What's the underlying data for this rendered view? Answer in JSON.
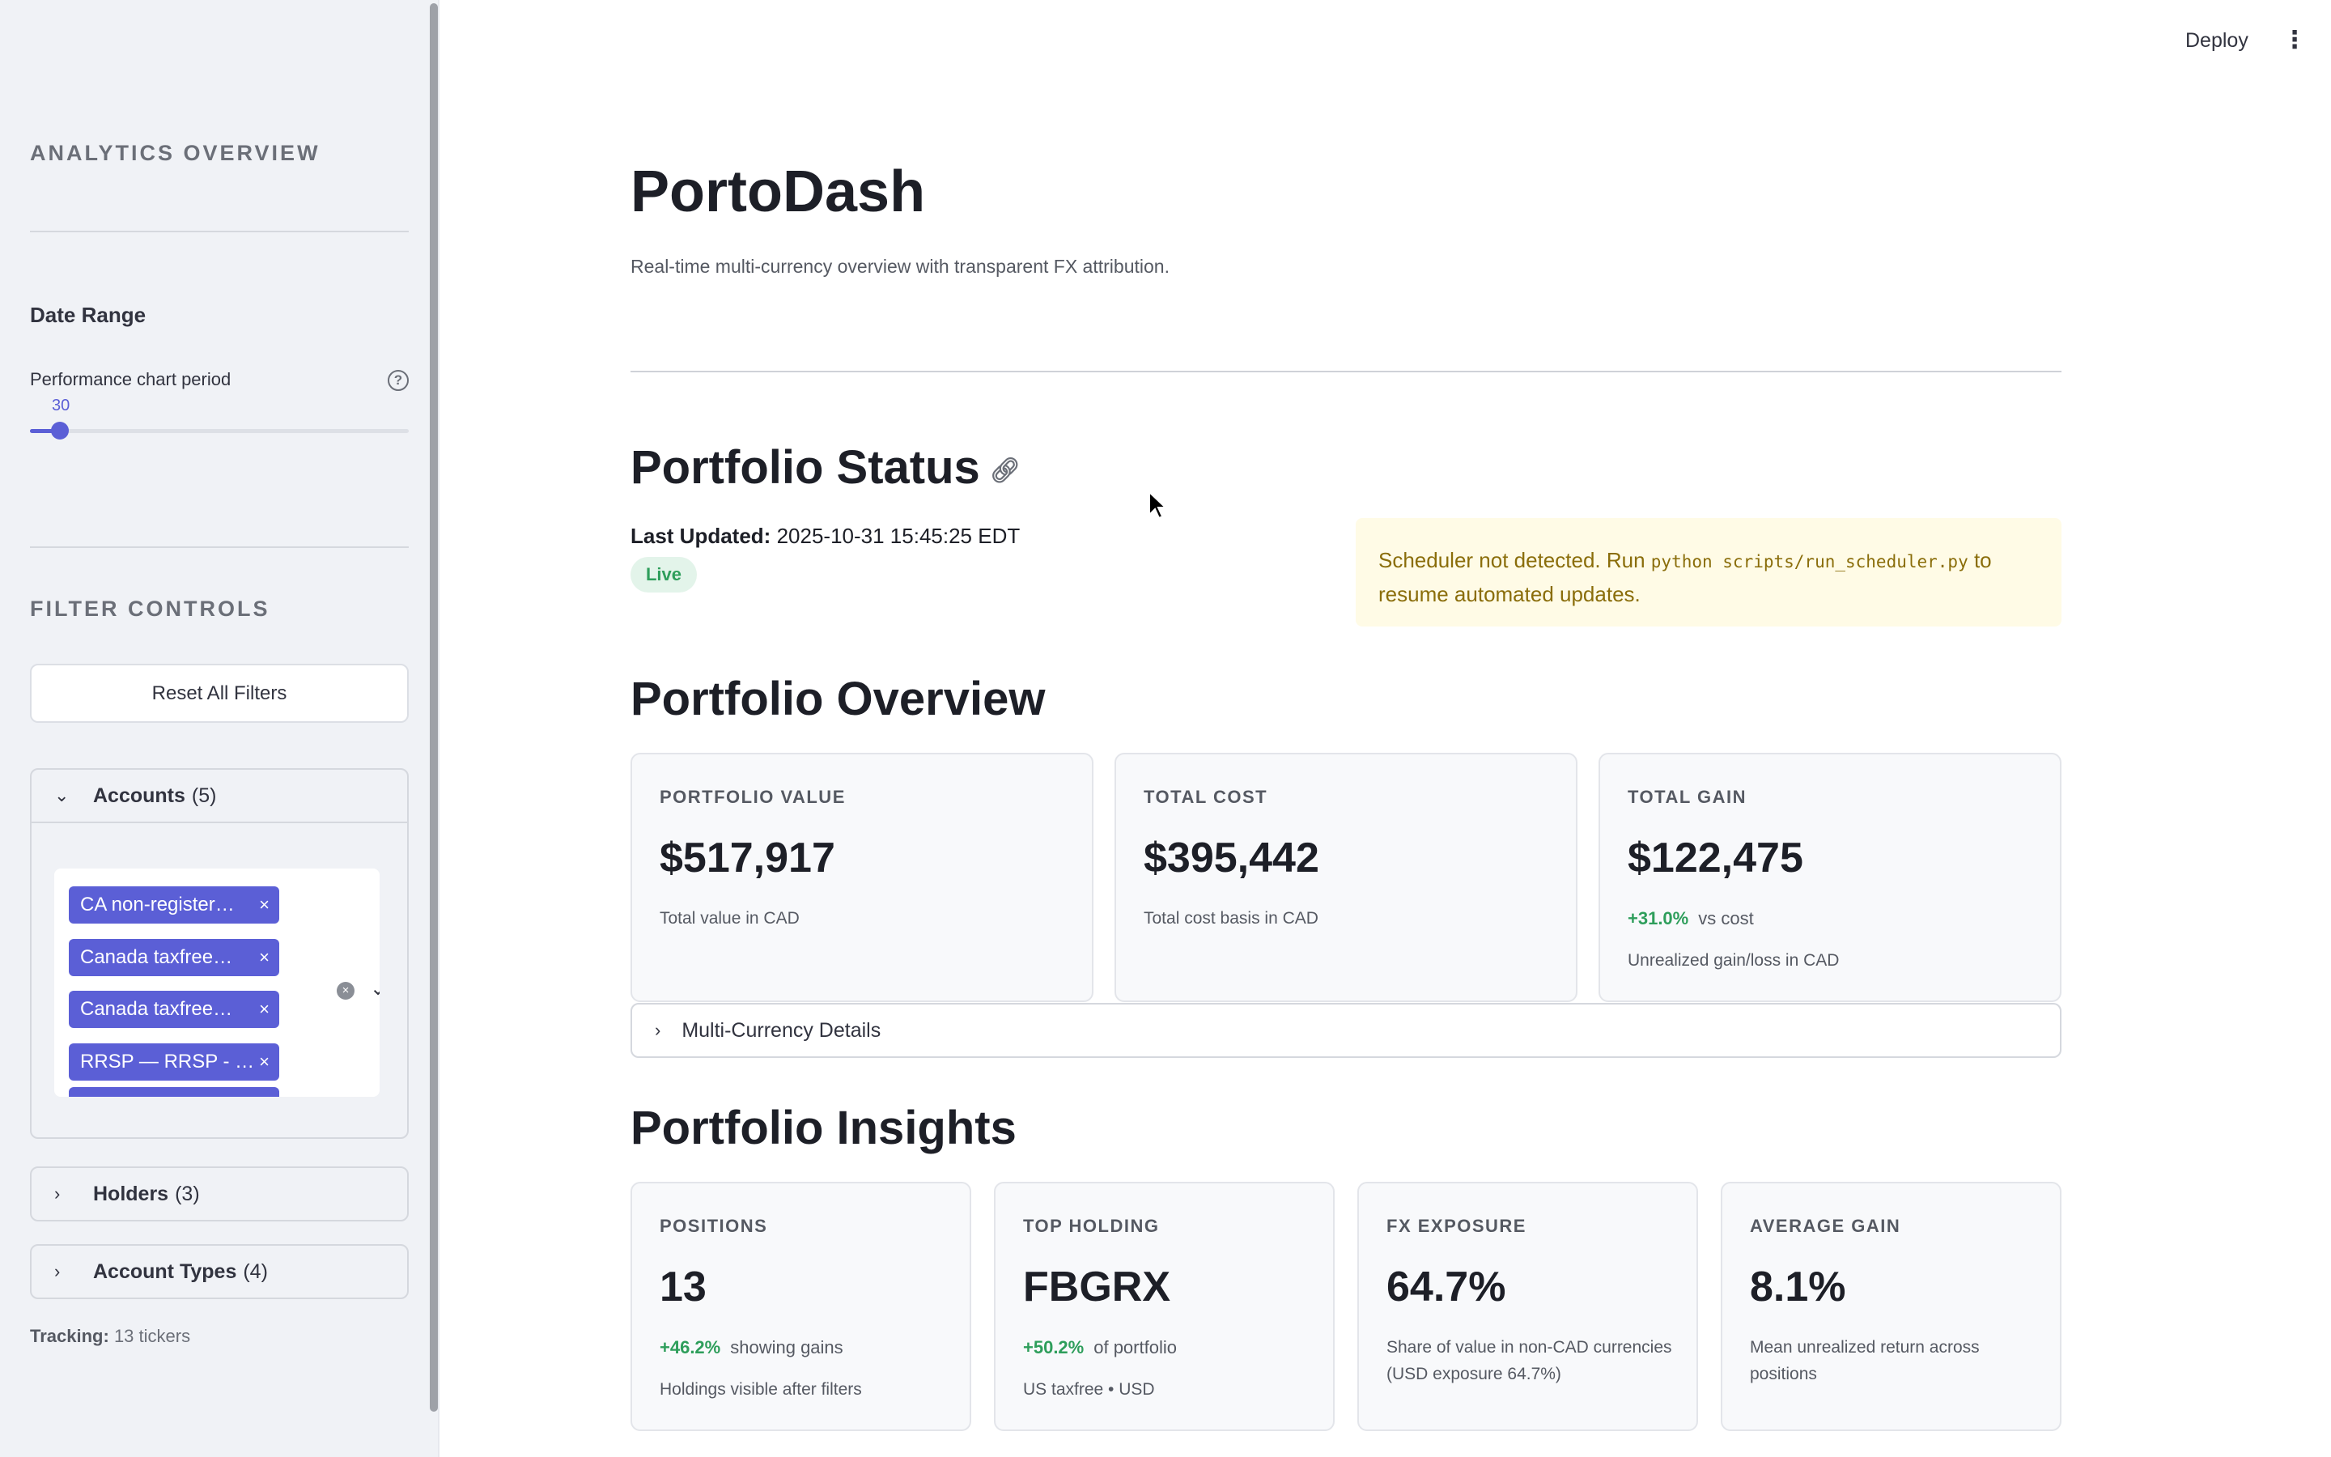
{
  "topbar": {
    "deploy_label": "Deploy",
    "menu_icon": "kebab-menu-icon"
  },
  "sidebar": {
    "section_analytics": "ANALYTICS OVERVIEW",
    "date_range_heading": "Date Range",
    "slider": {
      "label": "Performance chart period",
      "value": "30",
      "fraction": 0.08
    },
    "section_filters": "FILTER CONTROLS",
    "reset_label": "Reset All Filters",
    "accounts": {
      "title": "Accounts",
      "count": "(5)",
      "tags": [
        "CA non-register…",
        "Canada taxfree…",
        "Canada taxfree…",
        "RRSP — RRSP - …"
      ]
    },
    "holders": {
      "title": "Holders",
      "count": "(3)"
    },
    "account_types": {
      "title": "Account Types",
      "count": "(4)"
    },
    "tracking": {
      "label": "Tracking:",
      "value": "13 tickers"
    }
  },
  "main": {
    "title": "PortoDash",
    "subtitle": "Real-time multi-currency overview with transparent FX attribution.",
    "status": {
      "heading": "Portfolio Status",
      "last_updated_label": "Last Updated:",
      "last_updated_value": "2025-10-31 15:45:25 EDT",
      "badge": "Live",
      "warning_pre": "Scheduler not detected. Run ",
      "warning_code": "python scripts/run_scheduler.py",
      "warning_post": " to resume automated updates."
    },
    "overview": {
      "heading": "Portfolio Overview",
      "cards": [
        {
          "label": "PORTFOLIO VALUE",
          "value": "$517,917",
          "note": "Total value in CAD"
        },
        {
          "label": "TOTAL COST",
          "value": "$395,442",
          "note": "Total cost basis in CAD"
        },
        {
          "label": "TOTAL GAIN",
          "value": "$122,475",
          "delta": "+31.0%",
          "delta_text": "vs cost",
          "note": "Unrealized gain/loss in CAD"
        }
      ],
      "multi_currency_label": "Multi-Currency Details"
    },
    "insights": {
      "heading": "Portfolio Insights",
      "cards": [
        {
          "label": "POSITIONS",
          "value": "13",
          "delta": "+46.2%",
          "delta_text": "showing gains",
          "note": "Holdings visible after filters"
        },
        {
          "label": "TOP HOLDING",
          "value": "FBGRX",
          "delta": "+50.2%",
          "delta_text": "of portfolio",
          "note": "US taxfree • USD"
        },
        {
          "label": "FX EXPOSURE",
          "value": "64.7%",
          "note": "Share of value in non-CAD currencies (USD exposure 64.7%)"
        },
        {
          "label": "AVERAGE GAIN",
          "value": "8.1%",
          "note": "Mean unrealized return across positions"
        }
      ]
    }
  },
  "colors": {
    "accent": "#5b5fd6",
    "positive": "#2e9e5b",
    "warning_bg": "#fffbe6",
    "warning_text": "#8a6d0a"
  }
}
